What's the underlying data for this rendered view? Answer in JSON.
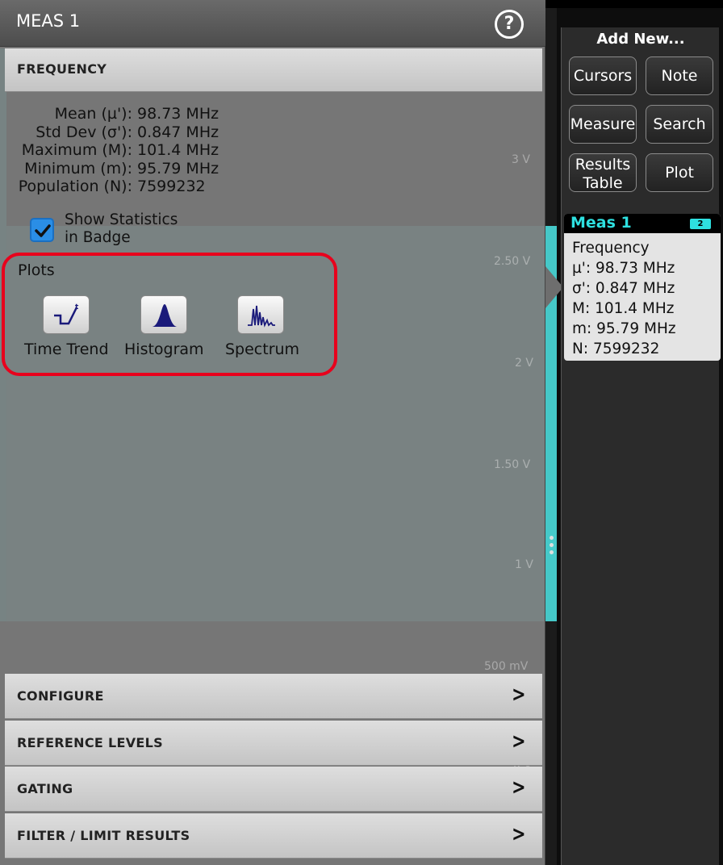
{
  "dialog": {
    "title": "MEAS 1",
    "help_glyph": "?",
    "frequency_section": "FREQUENCY",
    "stats": [
      {
        "label": "Mean (µ'):",
        "value": "98.73 MHz"
      },
      {
        "label": "Std Dev (σ'):",
        "value": "0.847 MHz"
      },
      {
        "label": "Maximum (M):",
        "value": "101.4 MHz"
      },
      {
        "label": "Minimum (m):",
        "value": "95.79 MHz"
      },
      {
        "label": "Population (N):",
        "value": "7599232"
      }
    ],
    "show_stats": {
      "line1": "Show Statistics",
      "line2": "in Badge",
      "checked": true
    },
    "plots": {
      "title": "Plots",
      "items": [
        {
          "label": "Time Trend",
          "icon": "time-trend-icon"
        },
        {
          "label": "Histogram",
          "icon": "histogram-icon"
        },
        {
          "label": "Spectrum",
          "icon": "spectrum-icon"
        }
      ]
    },
    "sections": [
      "CONFIGURE",
      "REFERENCE LEVELS",
      "GATING",
      "FILTER / LIMIT RESULTS"
    ]
  },
  "scope_axis": [
    "3 V",
    "2.50 V",
    "2 V",
    "1.50 V",
    "1 V",
    "500 mV",
    "0 V"
  ],
  "right_panel": {
    "title": "Add New...",
    "buttons": [
      {
        "label": "Cursors"
      },
      {
        "label": "Note"
      },
      {
        "label": "Measure"
      },
      {
        "label": "Search"
      },
      {
        "line1": "Results",
        "line2": "Table"
      },
      {
        "label": "Plot"
      }
    ]
  },
  "badge": {
    "title": "Meas 1",
    "channel": "2",
    "lines": [
      "Frequency",
      "µ': 98.73 MHz",
      "σ': 0.847 MHz",
      "M: 101.4 MHz",
      "m: 95.79 MHz",
      "N: 7599232"
    ]
  },
  "colors": {
    "channel_cyan": "#2ee0e0",
    "highlight_red": "#e8001c",
    "checkbox_blue": "#2a8ee6"
  }
}
